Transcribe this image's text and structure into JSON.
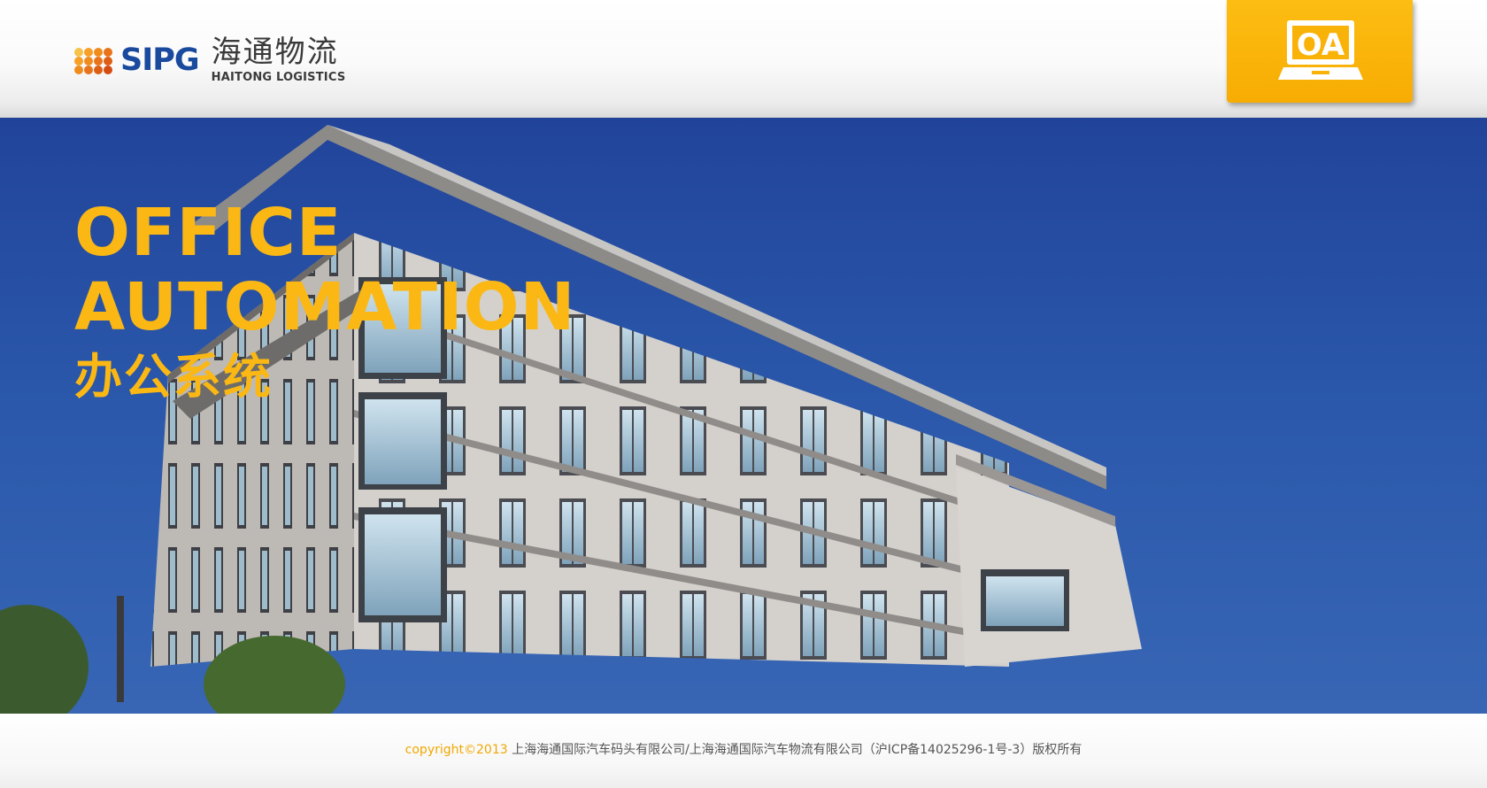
{
  "header": {
    "logo": {
      "brand": "SIPG",
      "name_cn": "海通物流",
      "name_en": "HAITONG LOGISTICS"
    },
    "oa_button": {
      "label": "OA",
      "icon": "laptop-icon"
    }
  },
  "hero": {
    "headline_line1": "OFFICE",
    "headline_line2": "AUTOMATION",
    "headline_cn": "办公系统"
  },
  "footer": {
    "copyright_prefix": "copyright©2013",
    "copyright_text": " 上海海通国际汽车码头有限公司/上海海通国际汽车物流有限公司（沪ICP备14025296-1号-3）版权所有"
  },
  "colors": {
    "accent": "#fbb814",
    "brand_blue": "#1a4a9e",
    "sky": "#2a57aa",
    "oa_button": "#f9b208"
  }
}
